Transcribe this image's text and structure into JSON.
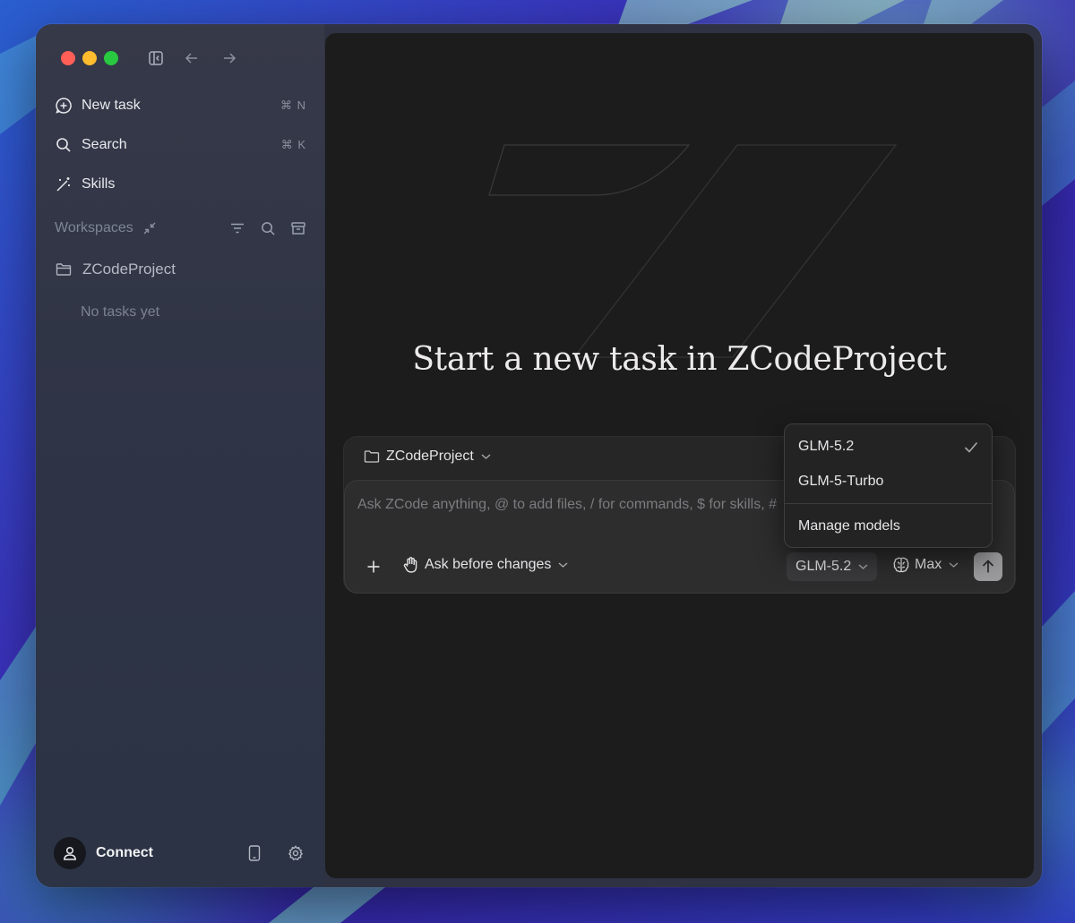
{
  "sidebar": {
    "nav": [
      {
        "label": "New task",
        "shortcut": "⌘ N",
        "icon": "new-task-icon"
      },
      {
        "label": "Search",
        "shortcut": "⌘ K",
        "icon": "search-icon"
      },
      {
        "label": "Skills",
        "shortcut": "",
        "icon": "magic-wand-icon"
      }
    ],
    "workspaces_label": "Workspaces",
    "project_name": "ZCodeProject",
    "no_tasks": "No tasks yet",
    "connect_label": "Connect"
  },
  "main": {
    "headline": "Start a new task in ZCodeProject",
    "composer": {
      "project_select": "ZCodeProject",
      "placeholder": "Ask ZCode anything, @ to add files, / for commands, $ for skills, #",
      "mode": "Ask before changes",
      "model": "GLM-5.2",
      "effort": "Max"
    },
    "model_menu": {
      "items": [
        {
          "label": "GLM-5.2",
          "selected": true
        },
        {
          "label": "GLM-5-Turbo",
          "selected": false
        }
      ],
      "manage": "Manage models"
    }
  },
  "colors": {
    "traffic_red": "#ff5f57",
    "traffic_yellow": "#febc2e",
    "traffic_green": "#28c840",
    "main_bg": "#1c1c1d",
    "send_button": "#9b9b9d"
  }
}
